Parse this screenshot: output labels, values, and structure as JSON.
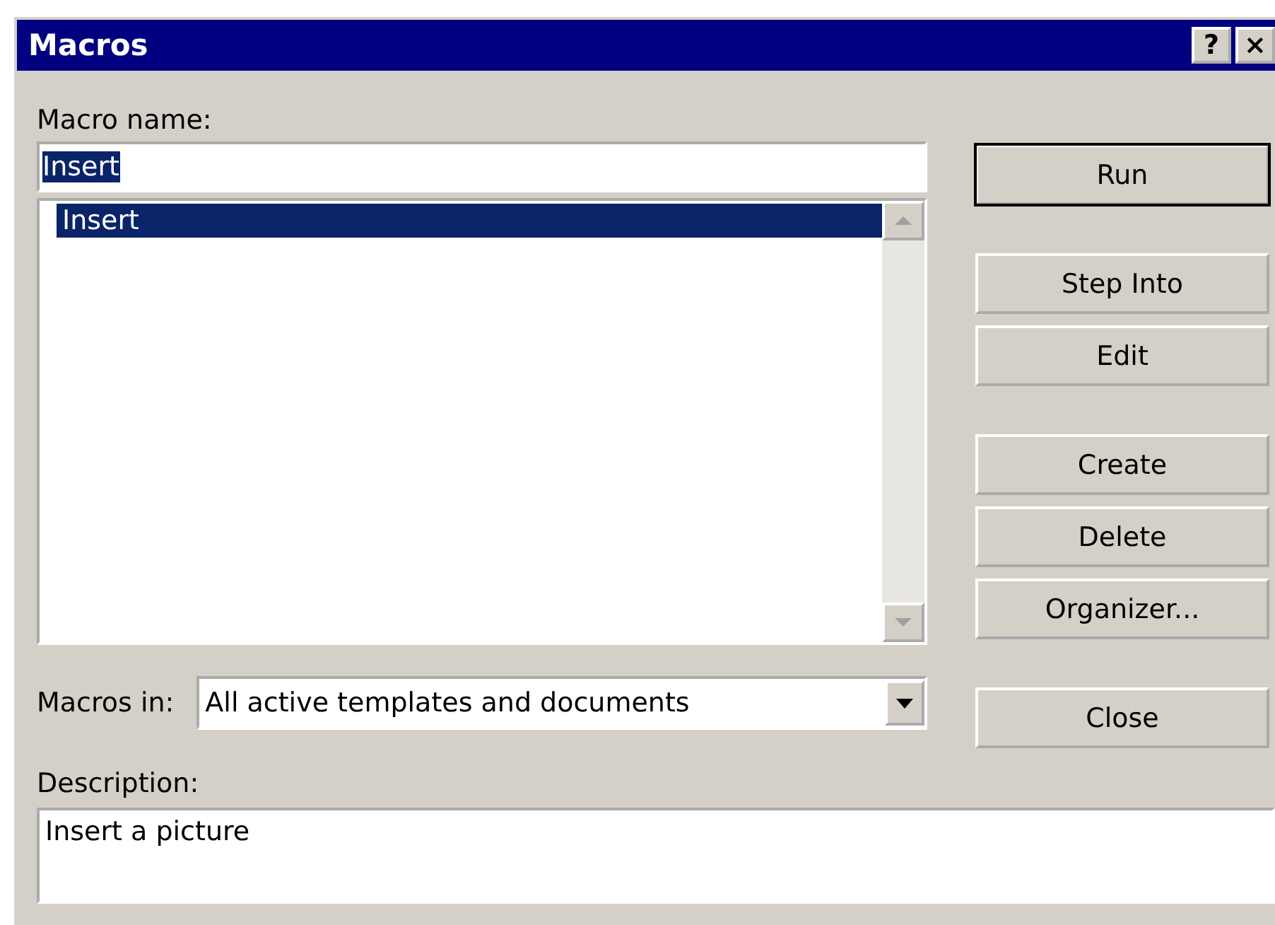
{
  "window": {
    "title": "Macros",
    "help_button": "?",
    "close_button": "×"
  },
  "macro_name": {
    "label": "Macro name:",
    "value": "Insert",
    "value_selected": true
  },
  "macro_list": {
    "items": [
      {
        "label": "Insert",
        "selected": true
      }
    ]
  },
  "macros_in": {
    "label": "Macros in:",
    "value": "All active templates and documents"
  },
  "description": {
    "label": "Description:",
    "value": "Insert a picture"
  },
  "button_groups": [
    [
      {
        "label": "Run",
        "default": true
      }
    ],
    [
      {
        "label": "Step Into",
        "default": false
      },
      {
        "label": "Edit",
        "default": false
      }
    ],
    [
      {
        "label": "Create",
        "default": false
      },
      {
        "label": "Delete",
        "default": false
      },
      {
        "label": "Organizer...",
        "default": false
      }
    ],
    [
      {
        "label": "Close",
        "default": false
      }
    ]
  ]
}
